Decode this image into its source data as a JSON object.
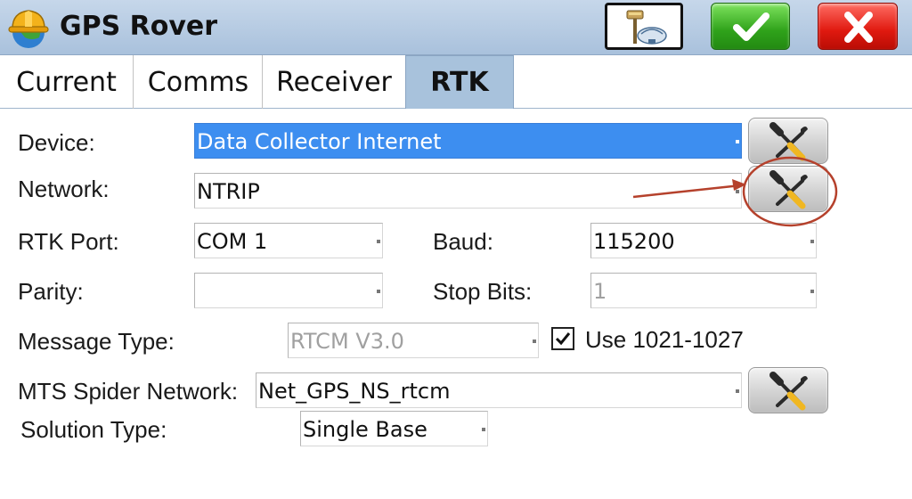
{
  "window": {
    "title": "GPS Rover",
    "logo_icon": "hardhat-globe-icon",
    "buttons": {
      "config_icon": "rover-config-icon",
      "ok_icon": "checkmark-icon",
      "cancel_label": "X"
    }
  },
  "tabs": [
    {
      "label": "Current",
      "active": false
    },
    {
      "label": "Comms",
      "active": false
    },
    {
      "label": "Receiver",
      "active": false
    },
    {
      "label": "RTK",
      "active": true
    }
  ],
  "form": {
    "device": {
      "label": "Device:",
      "value": "Data Collector Internet"
    },
    "network": {
      "label": "Network:",
      "value": "NTRIP"
    },
    "rtk_port": {
      "label": "RTK Port:",
      "value": "COM 1"
    },
    "baud": {
      "label": "Baud:",
      "value": "115200"
    },
    "parity": {
      "label": "Parity:",
      "value": ""
    },
    "stop_bits": {
      "label": "Stop Bits:",
      "value": "1"
    },
    "message_type": {
      "label": "Message Type:",
      "value": "RTCM V3.0"
    },
    "use_1021": {
      "label": "Use 1021-1027",
      "checked": true
    },
    "mts_spider": {
      "label": "MTS Spider Network:",
      "value": "Net_GPS_NS_rtcm"
    },
    "solution_type": {
      "label": "Solution Type:",
      "value": "Single Base"
    }
  },
  "colors": {
    "titlebar": "#b4c9e2",
    "active_tab": "#a8c2dc",
    "selection": "#3d8ef0",
    "annotation": "#b5412c"
  }
}
